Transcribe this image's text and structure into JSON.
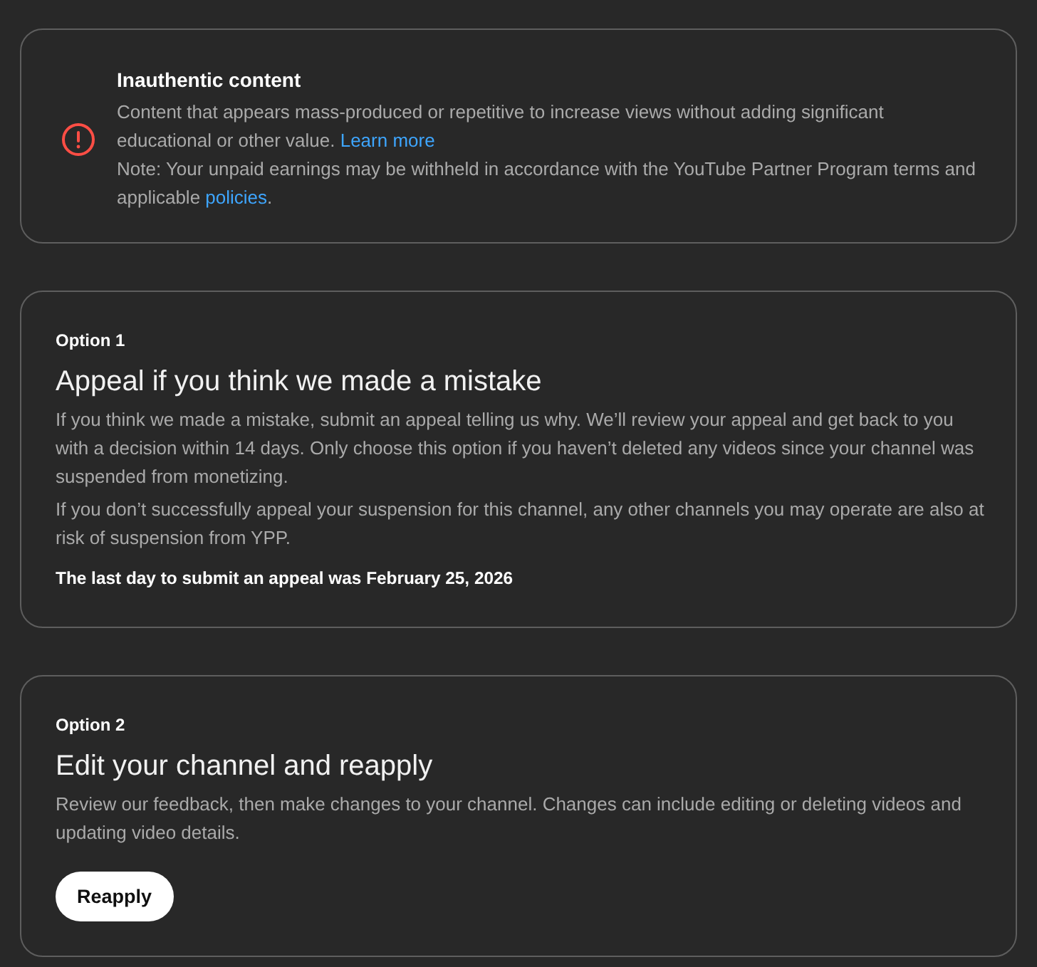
{
  "notice": {
    "title": "Inauthentic content",
    "description": {
      "text": "Content that appears mass-produced or repetitive to increase views without adding significant educational or other value.",
      "link": "Learn more"
    },
    "note": {
      "text": "Note: Your unpaid earnings may be withheld in accordance with the YouTube Partner Program terms and applicable",
      "link": "policies",
      "after": "."
    }
  },
  "options": [
    {
      "label": "Option 1",
      "title": "Appeal if you think we made a mistake",
      "paragraphs": [
        "If you think we made a mistake, submit an appeal telling us why. We’ll review your appeal and get back to you with a decision within 14 days. Only choose this option if you haven’t deleted any videos since your channel was suspended from monetizing.",
        "If you don’t successfully appeal your suspension for this channel, any other channels you may operate are also at risk of suspension from YPP."
      ],
      "deadline": "The last day to submit an appeal was February 25, 2026"
    },
    {
      "label": "Option 2",
      "title": "Edit your channel and reapply",
      "paragraphs": [
        "Review our feedback, then make changes to your channel. Changes can include editing or deleting videos and updating video details."
      ],
      "button": "Reapply"
    }
  ]
}
